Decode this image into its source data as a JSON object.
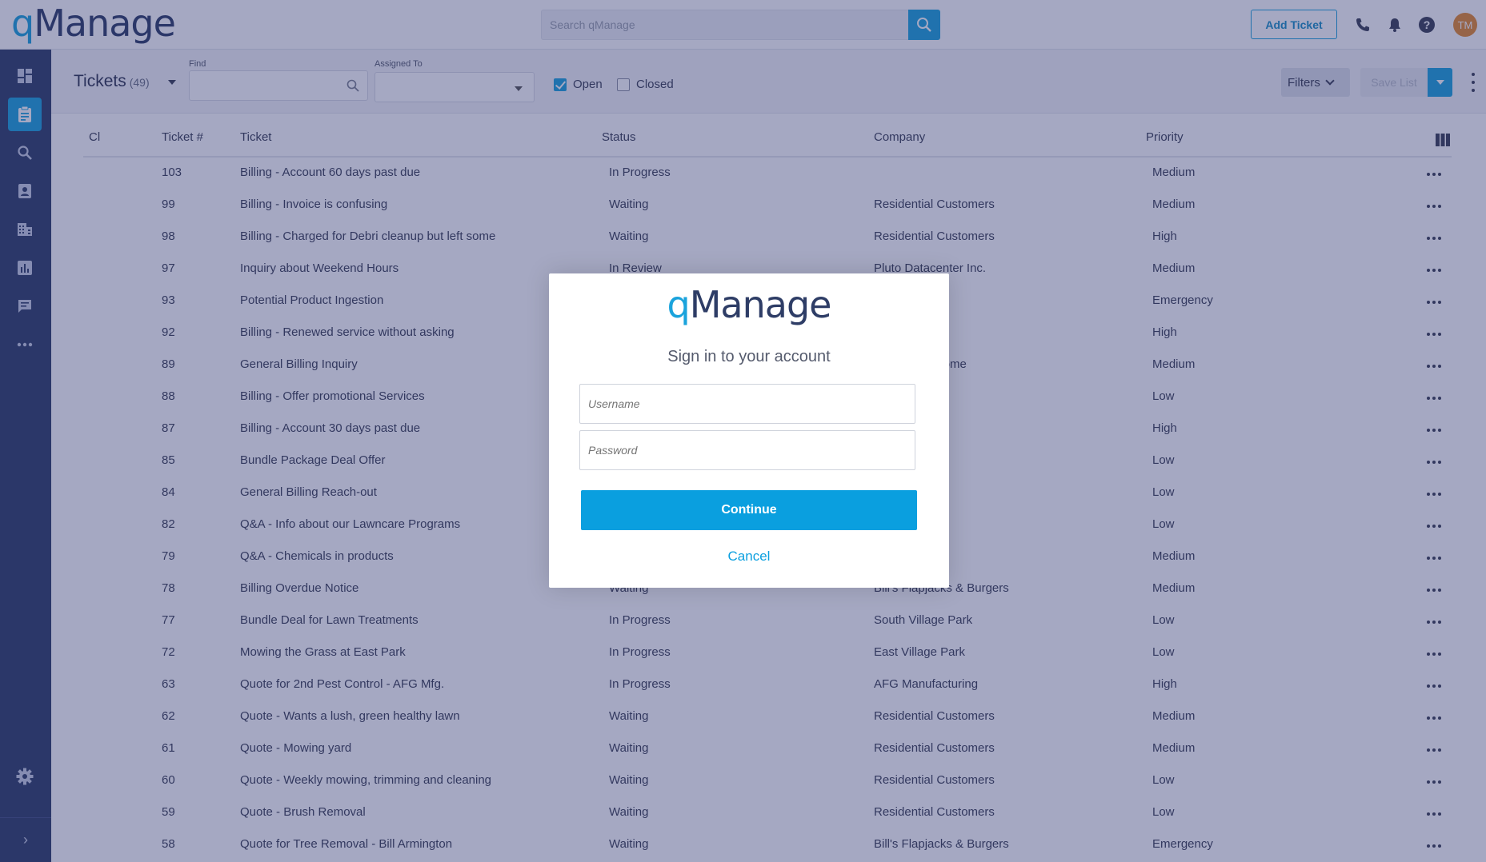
{
  "app": {
    "logo_q": "q",
    "logo_rest": "Manage",
    "search_placeholder": "Search qManage",
    "add_ticket_label": "Add Ticket",
    "avatar_initials": "TM",
    "brand_color": "#1aa3dc",
    "nav_color": "#2e3d66"
  },
  "sidebar": {
    "items": [
      {
        "name": "dashboard-icon",
        "active": false
      },
      {
        "name": "tickets-icon",
        "active": true
      },
      {
        "name": "search-icon",
        "active": false
      },
      {
        "name": "contacts-icon",
        "active": false
      },
      {
        "name": "companies-icon",
        "active": false
      },
      {
        "name": "reports-icon",
        "active": false
      },
      {
        "name": "messages-icon",
        "active": false
      },
      {
        "name": "more-icon",
        "active": false
      }
    ],
    "settings_icon": "gear-icon",
    "expand_icon": "chevron-right-icon",
    "expand_glyph": "›"
  },
  "filterbar": {
    "title": "Tickets",
    "count": "(49)",
    "find_label": "Find",
    "assigned_label": "Assigned To",
    "open_label": "Open",
    "open_checked": true,
    "closed_label": "Closed",
    "closed_checked": false,
    "filters_label": "Filters",
    "save_list_label": "Save List"
  },
  "table": {
    "headers": {
      "cl": "Cl",
      "number": "Ticket #",
      "ticket": "Ticket",
      "status": "Status",
      "company": "Company",
      "priority": "Priority"
    },
    "rows": [
      {
        "num": "103",
        "ticket": "Billing - Account 60 days past due",
        "status": "In Progress",
        "company": "",
        "priority": "Medium"
      },
      {
        "num": "99",
        "ticket": "Billing - Invoice is confusing",
        "status": "Waiting",
        "company": "Residential Customers",
        "priority": "Medium"
      },
      {
        "num": "98",
        "ticket": "Billing - Charged for Debri cleanup but left some",
        "status": "Waiting",
        "company": "Residential Customers",
        "priority": "High"
      },
      {
        "num": "97",
        "ticket": "Inquiry about Weekend Hours",
        "status": "In Review",
        "company": "Pluto Datacenter Inc.",
        "priority": "Medium"
      },
      {
        "num": "93",
        "ticket": "Potential Product Ingestion",
        "status": "",
        "company": "Park",
        "priority": "Emergency"
      },
      {
        "num": "92",
        "ticket": "Billing - Renewed service without asking",
        "status": "",
        "company": "ustomers",
        "priority": "High"
      },
      {
        "num": "89",
        "ticket": "General Billing Inquiry",
        "status": "",
        "company": "sted Living Home",
        "priority": "Medium"
      },
      {
        "num": "88",
        "ticket": "Billing - Offer promotional Services",
        "status": "",
        "company": "ustomers",
        "priority": "Low"
      },
      {
        "num": "87",
        "ticket": "Billing - Account 30 days past due",
        "status": "",
        "company": "ustomers",
        "priority": "High"
      },
      {
        "num": "85",
        "ticket": "Bundle Package Deal Offer",
        "status": "",
        "company": "ark",
        "priority": "Low"
      },
      {
        "num": "84",
        "ticket": "General Billing Reach-out",
        "status": "",
        "company": "cturing",
        "priority": "Low"
      },
      {
        "num": "82",
        "ticket": "Q&A - Info about our Lawncare Programs",
        "status": "",
        "company": "ustomers",
        "priority": "Low"
      },
      {
        "num": "79",
        "ticket": "Q&A - Chemicals in products",
        "status": "",
        "company": "ustomers",
        "priority": "Medium"
      },
      {
        "num": "78",
        "ticket": "Billing Overdue Notice",
        "status": "Waiting",
        "company": "Bill's Flapjacks & Burgers",
        "priority": "Medium"
      },
      {
        "num": "77",
        "ticket": "Bundle Deal for Lawn Treatments",
        "status": "In Progress",
        "company": "South Village Park",
        "priority": "Low"
      },
      {
        "num": "72",
        "ticket": "Mowing the Grass at East Park",
        "status": "In Progress",
        "company": "East Village Park",
        "priority": "Low"
      },
      {
        "num": "63",
        "ticket": "Quote for 2nd Pest Control - AFG Mfg.",
        "status": "In Progress",
        "company": "AFG Manufacturing",
        "priority": "High"
      },
      {
        "num": "62",
        "ticket": "Quote - Wants a lush, green healthy lawn",
        "status": "Waiting",
        "company": "Residential Customers",
        "priority": "Medium"
      },
      {
        "num": "61",
        "ticket": "Quote - Mowing yard",
        "status": "Waiting",
        "company": "Residential Customers",
        "priority": "Medium"
      },
      {
        "num": "60",
        "ticket": "Quote - Weekly mowing, trimming and cleaning",
        "status": "Waiting",
        "company": "Residential Customers",
        "priority": "Low"
      },
      {
        "num": "59",
        "ticket": "Quote - Brush Removal",
        "status": "Waiting",
        "company": "Residential Customers",
        "priority": "Low"
      },
      {
        "num": "58",
        "ticket": "Quote for Tree Removal - Bill Armington",
        "status": "Waiting",
        "company": "Bill's Flapjacks & Burgers",
        "priority": "Emergency"
      }
    ]
  },
  "modal": {
    "logo_q": "q",
    "logo_rest": "Manage",
    "subtitle": "Sign in to your account",
    "username_placeholder": "Username",
    "password_placeholder": "Password",
    "continue_label": "Continue",
    "cancel_label": "Cancel"
  }
}
